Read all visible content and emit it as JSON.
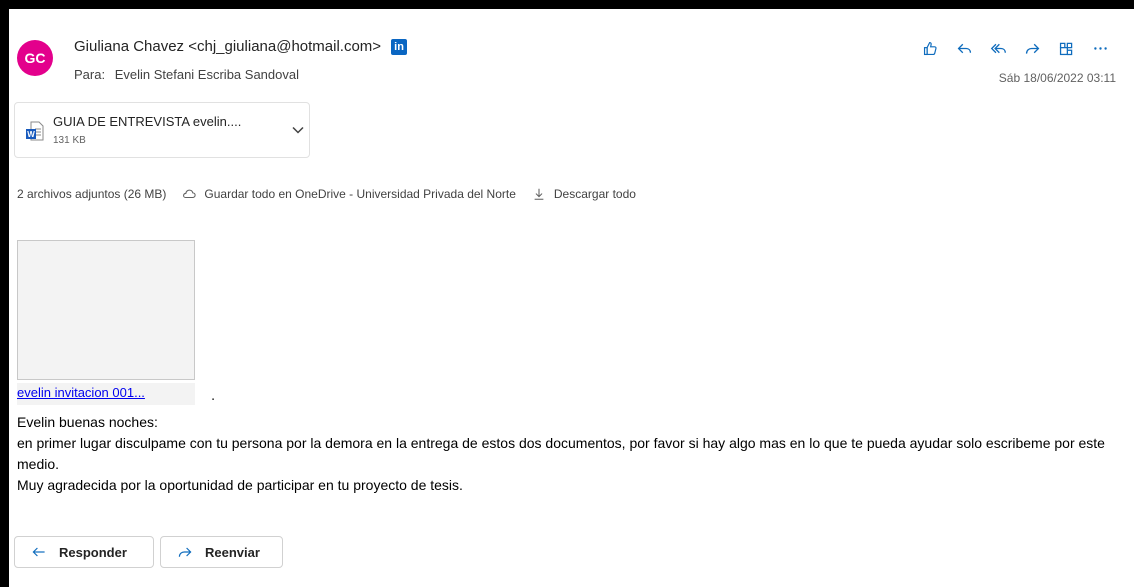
{
  "header": {
    "avatar_initials": "GC",
    "from": "Giuliana Chavez <chj_giuliana@hotmail.com>",
    "linkedin_badge": "in",
    "to_label": "Para:",
    "to": "Evelin Stefani Escriba Sandoval",
    "date": "Sáb 18/06/2022 03:11",
    "actions": [
      "like-icon",
      "reply-icon",
      "reply-all-icon",
      "forward-icon",
      "apps-icon",
      "more-icon"
    ]
  },
  "attachment": {
    "name": "GUIA DE ENTREVISTA evelin....",
    "size": "131 KB",
    "icon": "word-file-icon"
  },
  "attachments_bar": {
    "count_text": "2 archivos adjuntos (26 MB)",
    "save_onedrive": "Guardar todo en OneDrive - Universidad Privada del Norte",
    "download_all": "Descargar todo"
  },
  "inline_image": {
    "caption": "evelin invitacion 001..."
  },
  "body": {
    "trailing_dot": ".",
    "lines": [
      "Evelin buenas noches:",
      "en primer lugar disculpame con tu persona por la demora en la entrega de estos dos documentos, por favor si hay algo mas en lo que te pueda ayudar solo escribeme por este medio.",
      "Muy agradecida por la oportunidad de participar en tu proyecto de tesis."
    ]
  },
  "footer": {
    "reply_label": "Responder",
    "forward_label": "Reenviar"
  },
  "colors": {
    "accent": "#0f6cbd",
    "avatar": "#e3008c",
    "linkedin": "#0a66c2"
  }
}
